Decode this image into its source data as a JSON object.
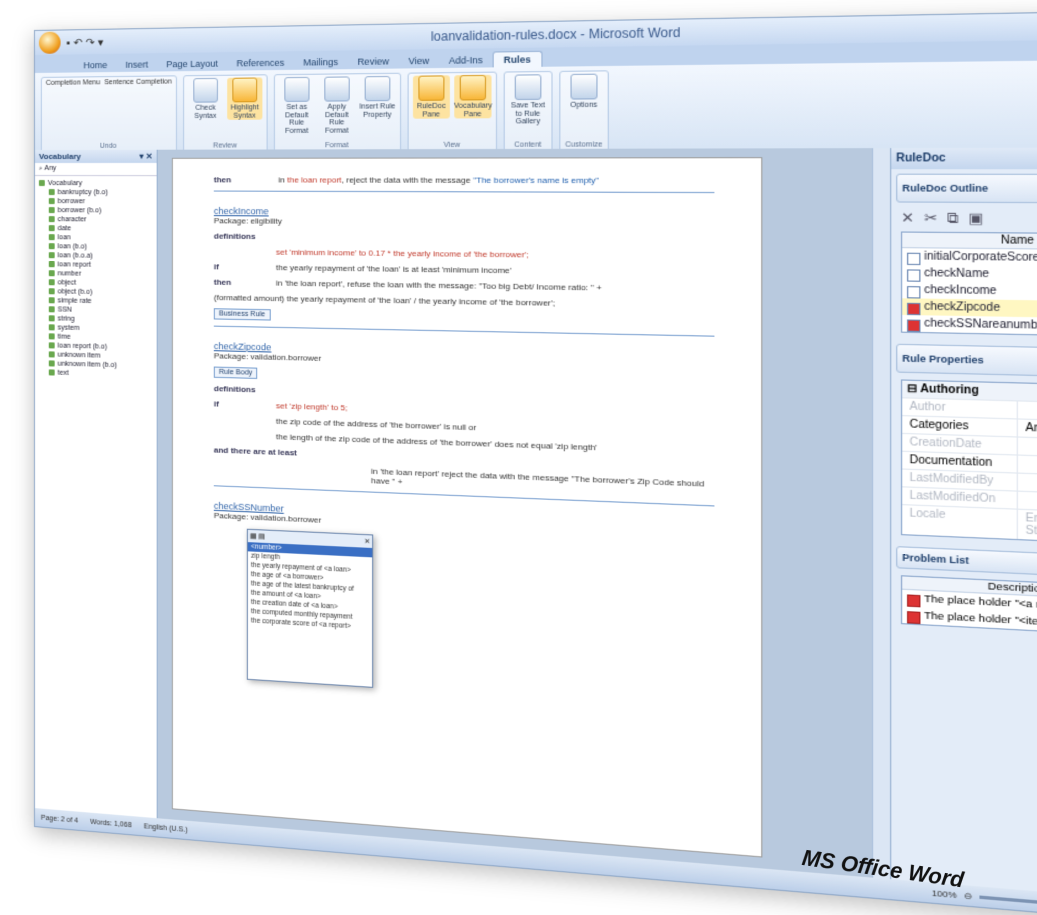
{
  "window": {
    "title": "loanvalidation-rules.docx - Microsoft Word",
    "controls": "– ▫ ✕"
  },
  "qat": "▪ ↶ ↷ ▾",
  "tabs": [
    "Home",
    "Insert",
    "Page Layout",
    "References",
    "Mailings",
    "Review",
    "View",
    "Add-Ins",
    "Rules"
  ],
  "active_tab": "Rules",
  "ribbon": {
    "groups": [
      {
        "title": "Undo",
        "buttons": [],
        "options": [
          "Completion Menu",
          "Sentence Completion"
        ]
      },
      {
        "title": "Review",
        "buttons": [
          {
            "label": "Check Syntax",
            "hl": false
          },
          {
            "label": "Highlight Syntax",
            "hl": true
          }
        ]
      },
      {
        "title": "Format",
        "buttons": [
          {
            "label": "Set as Default Rule Format",
            "hl": false
          },
          {
            "label": "Apply Default Rule Format",
            "hl": false
          },
          {
            "label": "Insert Rule Property",
            "hl": false
          }
        ]
      },
      {
        "title": "View",
        "buttons": [
          {
            "label": "RuleDoc Pane",
            "hl": true
          },
          {
            "label": "Vocabulary Pane",
            "hl": true
          }
        ]
      },
      {
        "title": "Content",
        "buttons": [
          {
            "label": "Save Text to Rule Gallery",
            "hl": false
          }
        ]
      },
      {
        "title": "Customize",
        "buttons": [
          {
            "label": "Options",
            "hl": false
          }
        ]
      }
    ]
  },
  "vocabulary": {
    "title": "Vocabulary",
    "filter": "Any",
    "items": [
      "Vocabulary",
      "bankruptcy (b.o)",
      "borrower",
      "borrower (b.o)",
      "character",
      "date",
      "loan",
      "loan (b.o)",
      "loan (b.o.a)",
      "loan report",
      "number",
      "object",
      "object (b.o)",
      "simple rate",
      "SSN",
      "string",
      "system",
      "time",
      "loan report (b.o)",
      "unknown item",
      "unknown item (b.o)",
      "text"
    ]
  },
  "document": {
    "then_kw": "then",
    "if_kw": "if",
    "def_kw": "definitions",
    "and_kw": "and there are at least",
    "line1_pre": "in",
    "line1_obj": "the loan report",
    "line1_post": ", reject the data with the message",
    "line1_msg": "\"The borrower's name is empty\"",
    "rule2_title": "checkIncome",
    "rule2_pkg": "Package: eligibility",
    "rule2_set": "set 'minimum income' to 0.17 * the yearly income of 'the borrower';",
    "rule2_if": "the yearly repayment of 'the loan' is at least 'minimum income'",
    "rule2_then": "in 'the loan report', refuse the loan with the message: \"Too big Debt/ Income ratio: \" +",
    "rule2_then2": "(formatted amount) the yearly repayment of 'the loan' / the yearly income of 'the borrower';",
    "badge": "Business Rule",
    "rule3_title": "checkZipcode",
    "rule3_pkg": "Package: validation.borrower",
    "rule3_kind": "Rule Body",
    "rule3_set": "set 'zip length' to 5;",
    "rule3_if1": "the zip code of the address of 'the borrower' is null or",
    "rule3_if2": "the length of the zip code of the address of 'the borrower' does not equal 'zip length'",
    "rule3_then": "in 'the loan report' reject the data with the message \"The borrower's Zip Code should have \" +",
    "rule4_title": "checkSSNumber",
    "rule4_pkg": "Package: validation.borrower"
  },
  "popup": {
    "items": [
      "<number>",
      "zip length",
      "the yearly repayment of <a loan>",
      "the age of <a borrower>",
      "the age of the latest bankruptcy of",
      "the amount of <a loan>",
      "the creation date of <a loan>",
      "the computed monthly repayment",
      "the corporate score of <a report>"
    ],
    "selected": 0
  },
  "ruledoc": {
    "title": "RuleDoc",
    "outline_title": "RuleDoc Outline",
    "grid_header": "Name",
    "rows": [
      {
        "name": "initialCorporateScore",
        "error": false,
        "selected": false
      },
      {
        "name": "checkName",
        "error": false,
        "selected": false
      },
      {
        "name": "checkIncome",
        "error": false,
        "selected": false
      },
      {
        "name": "checkZipcode",
        "error": true,
        "selected": true
      },
      {
        "name": "checkSSNareanumber",
        "error": true,
        "selected": false
      }
    ],
    "props_title": "Rule Properties",
    "props_category": "Authoring",
    "props": [
      {
        "k": "Author",
        "v": "",
        "grey": true
      },
      {
        "k": "Categories",
        "v": "Any",
        "grey": false
      },
      {
        "k": "CreationDate",
        "v": "",
        "grey": true
      },
      {
        "k": "Documentation",
        "v": "",
        "grey": false
      },
      {
        "k": "LastModifiedBy",
        "v": "",
        "grey": true
      },
      {
        "k": "LastModifiedOn",
        "v": "",
        "grey": true
      },
      {
        "k": "Locale",
        "v": "English (United Sta",
        "grey": true
      }
    ],
    "problems_title": "Problem List",
    "problems_header": "Description",
    "problems": [
      "The place holder \"<a number>\" is not",
      "The place holder \"<item>\" is not filled"
    ]
  },
  "status": {
    "page": "Page: 2 of 4",
    "words": "Words: 1,068",
    "lang": "English (U.S.)",
    "zoom": "100%"
  },
  "caption": "MS Office Word"
}
